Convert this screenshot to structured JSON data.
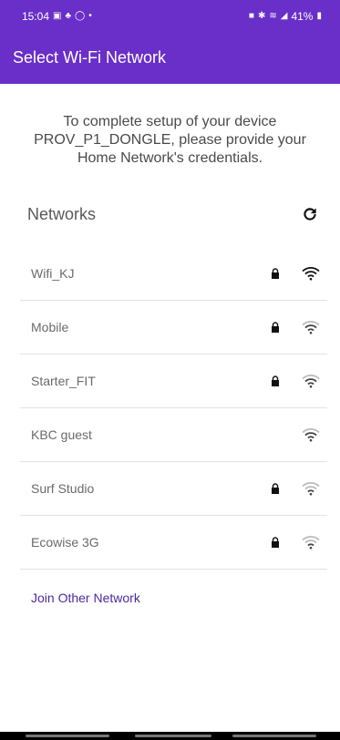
{
  "status_bar": {
    "time": "15:04",
    "battery": "41%",
    "left_icons": [
      "gallery-icon",
      "teams-icon",
      "whatsapp-icon",
      "dot-icon"
    ],
    "right_icons": [
      "nfc-icon",
      "bluetooth-icon",
      "wifi-calling-icon",
      "signal-icon",
      "battery-icon"
    ]
  },
  "app_bar": {
    "title": "Select Wi-Fi Network",
    "color": "#6a2fc8"
  },
  "intro_text": "To complete setup of your device PROV_P1_DONGLE, please provide your Home Network's credentials.",
  "networks_section": {
    "label": "Networks",
    "refresh_icon": "refresh-icon"
  },
  "networks": [
    {
      "name": "Wifi_KJ",
      "secured": true,
      "signal": "strong"
    },
    {
      "name": "Mobile",
      "secured": true,
      "signal": "medium"
    },
    {
      "name": "Starter_FIT",
      "secured": true,
      "signal": "medium"
    },
    {
      "name": "KBC guest",
      "secured": false,
      "signal": "medium"
    },
    {
      "name": "Surf Studio",
      "secured": true,
      "signal": "weak"
    },
    {
      "name": "Ecowise 3G",
      "secured": true,
      "signal": "weak"
    }
  ],
  "join_other": "Join Other Network",
  "colors": {
    "primary": "#6a2fc8",
    "link": "#4b2aa0",
    "text": "#4a4a4a"
  }
}
